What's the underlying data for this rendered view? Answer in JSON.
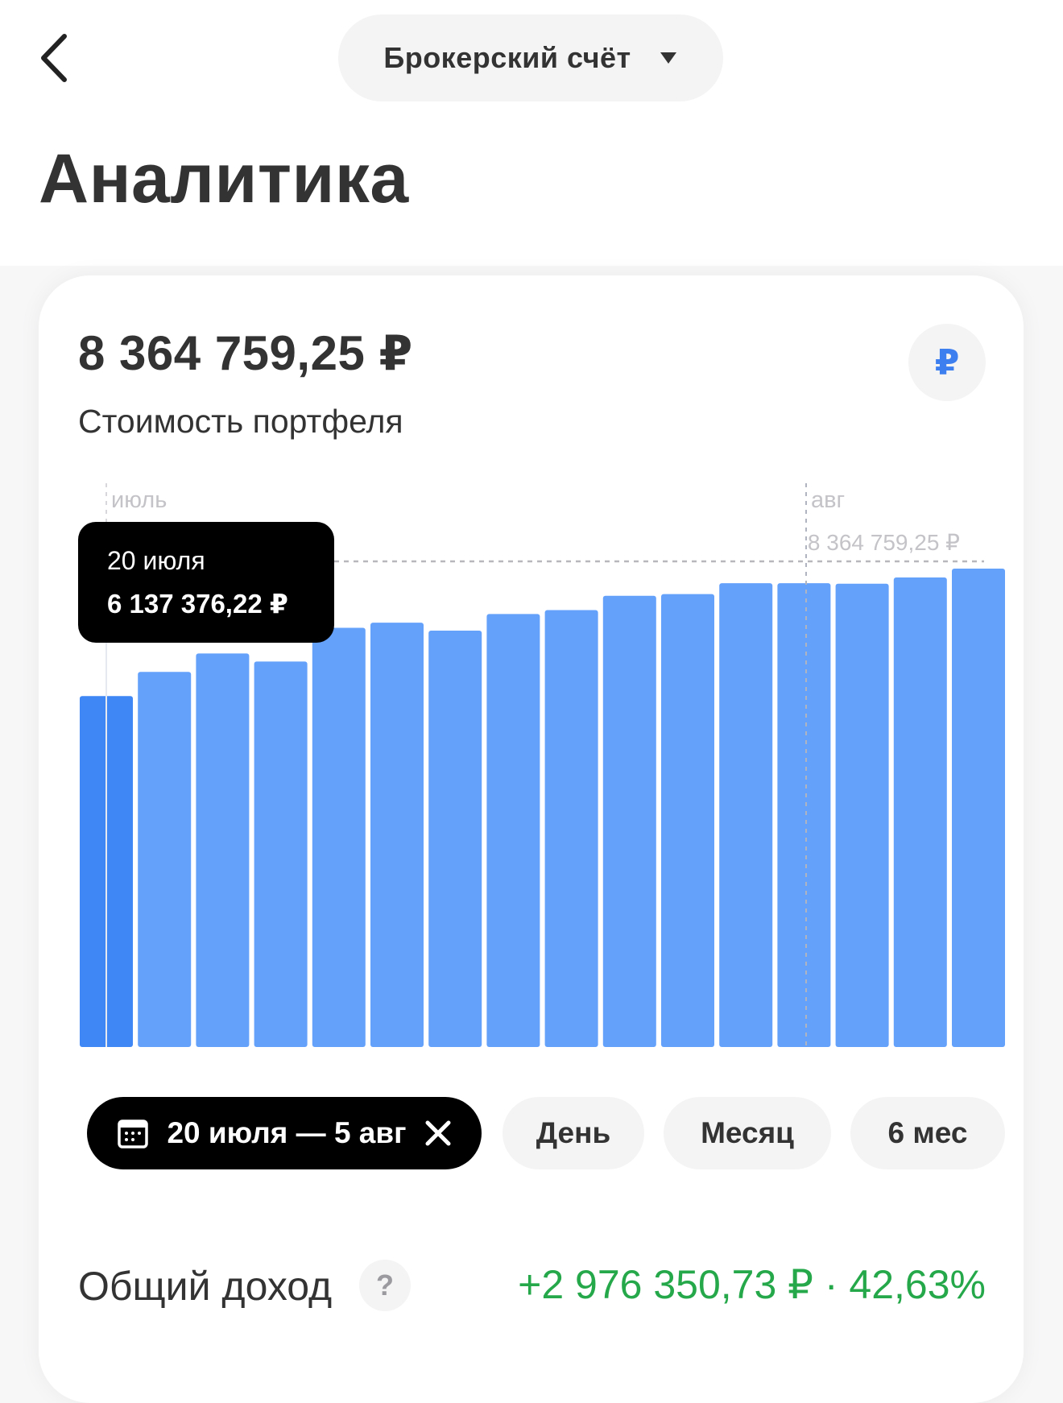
{
  "header": {
    "account_selector_label": "Брокерский счёт",
    "back_icon": "chevron-left-icon",
    "dropdown_icon": "caret-down-icon"
  },
  "page": {
    "title": "Аналитика"
  },
  "portfolio": {
    "value": "8 364 759,25 ₽",
    "subtitle": "Стоимость портфеля",
    "currency_symbol": "₽"
  },
  "chart_data": {
    "type": "bar",
    "x_labels": [
      {
        "text": "июль"
      },
      {
        "text": "авг"
      }
    ],
    "reference_line": {
      "label": "8 364 759,25 ₽",
      "value": 8364759.25
    },
    "values": [
      6137376.22,
      6560000,
      6880000,
      6740000,
      7330000,
      7420000,
      7280000,
      7570000,
      7640000,
      7890000,
      7920000,
      8110000,
      8110000,
      8100000,
      8210000,
      8364759.25
    ],
    "selected_index": 0,
    "ylim": [
      0,
      8364759.25
    ],
    "colors": {
      "bar": "#64a1fb",
      "selected_bar": "#3f87f5"
    }
  },
  "tooltip": {
    "date": "20 июля",
    "value": "6 137 376,22 ₽"
  },
  "periods": {
    "range_label": "20 июля — 5 авг",
    "calendar_icon": "calendar-icon",
    "close_icon": "close-icon",
    "options": [
      "День",
      "Месяц",
      "6 мес"
    ]
  },
  "income": {
    "label": "Общий доход",
    "help": "?",
    "value": "+2 976 350,73 ₽ · 42,63%"
  },
  "colors": {
    "accent_blue": "#3d7fef",
    "positive_green": "#25a84a",
    "text": "#333333",
    "chip_bg": "#f4f4f5"
  }
}
